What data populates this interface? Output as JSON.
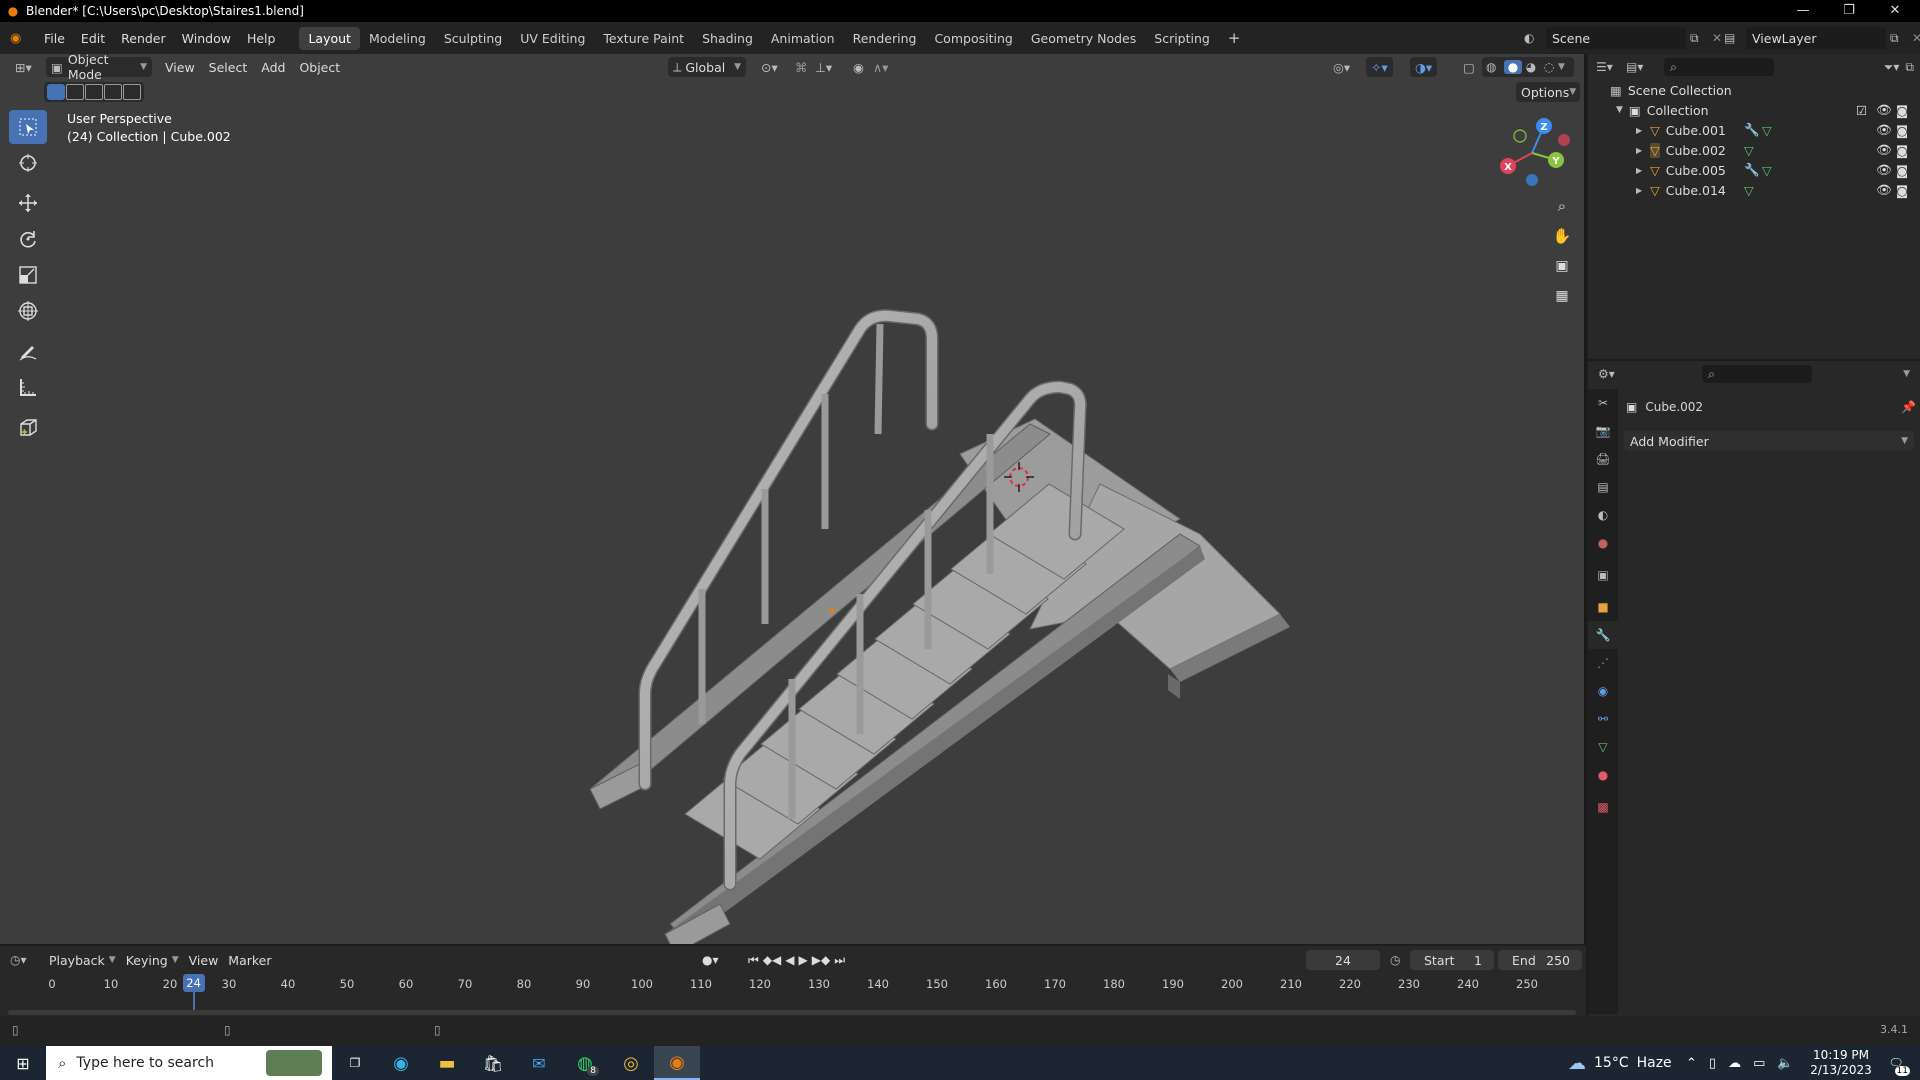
{
  "window": {
    "title": "Blender* [C:\\Users\\pc\\Desktop\\Staires1.blend]",
    "minimize": "—",
    "maximize": "❐",
    "close": "✕"
  },
  "topbar": {
    "menus": [
      "File",
      "Edit",
      "Render",
      "Window",
      "Help"
    ],
    "workspaces": [
      "Layout",
      "Modeling",
      "Sculpting",
      "UV Editing",
      "Texture Paint",
      "Shading",
      "Animation",
      "Rendering",
      "Compositing",
      "Geometry Nodes",
      "Scripting"
    ],
    "active_workspace": "Layout",
    "add_workspace": "+",
    "scene": "Scene",
    "view_layer": "ViewLayer"
  },
  "viewport": {
    "mode": "Object Mode",
    "menus": [
      "View",
      "Select",
      "Add",
      "Object"
    ],
    "orientation": "Global",
    "options_label": "Options",
    "info_line1": "User Perspective",
    "info_line2": "(24) Collection | Cube.002",
    "gizmo": {
      "x": "X",
      "y": "Y",
      "z": "Z"
    }
  },
  "outliner": {
    "scene_collection": "Scene Collection",
    "collection": "Collection",
    "objects": [
      {
        "name": "Cube.001",
        "modifier": true
      },
      {
        "name": "Cube.002",
        "modifier": false
      },
      {
        "name": "Cube.005",
        "modifier": true
      },
      {
        "name": "Cube.014",
        "modifier": false
      }
    ]
  },
  "properties": {
    "object_name": "Cube.002",
    "add_modifier": "Add Modifier"
  },
  "timeline": {
    "menus": [
      "Playback",
      "Keying",
      "View",
      "Marker"
    ],
    "current_frame": "24",
    "start_label": "Start",
    "start_value": "1",
    "end_label": "End",
    "end_value": "250",
    "ticks": [
      "0",
      "10",
      "20",
      "30",
      "40",
      "50",
      "60",
      "70",
      "80",
      "90",
      "100",
      "110",
      "120",
      "130",
      "140",
      "150",
      "160",
      "170",
      "180",
      "190",
      "200",
      "210",
      "220",
      "230",
      "240",
      "250"
    ]
  },
  "statusbar": {
    "version": "3.4.1"
  },
  "taskbar": {
    "search_placeholder": "Type here to search",
    "weather_temp": "15°C",
    "weather_text": "Haze",
    "time": "10:19 PM",
    "date": "2/13/2023",
    "whatsapp_badge": "8",
    "notif_count": "11"
  },
  "colors": {
    "accent": "#4772b3",
    "viewport_bg": "#3d3d3d",
    "panel_bg": "#282828",
    "blender_orange": "#e87d0d",
    "playhead": "#4772b3",
    "axis_x": "#e0435a",
    "axis_y": "#8bc53f",
    "axis_z": "#3b8ced"
  }
}
